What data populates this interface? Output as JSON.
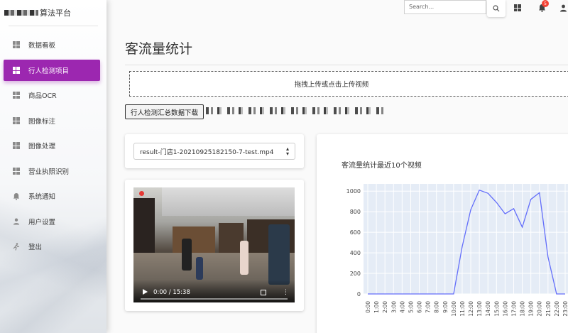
{
  "sidebar": {
    "logo_text": "算法平台",
    "items": [
      {
        "label": "数据看板",
        "icon": "dashboard-icon",
        "active": false
      },
      {
        "label": "行人检测项目",
        "icon": "dashboard-icon",
        "active": true
      },
      {
        "label": "商品OCR",
        "icon": "dashboard-icon",
        "active": false
      },
      {
        "label": "图像标注",
        "icon": "dashboard-icon",
        "active": false
      },
      {
        "label": "图像处理",
        "icon": "dashboard-icon",
        "active": false
      },
      {
        "label": "营业执照识别",
        "icon": "dashboard-icon",
        "active": false
      },
      {
        "label": "系统通知",
        "icon": "bell-icon",
        "active": false
      },
      {
        "label": "用户设置",
        "icon": "person-icon",
        "active": false
      },
      {
        "label": "登出",
        "icon": "run-icon",
        "active": false
      }
    ]
  },
  "topbar": {
    "search_placeholder": "Search...",
    "notification_count": "5"
  },
  "main": {
    "title": "客流量统计",
    "upload_text": "拖拽上传或点击上传视频",
    "download_button": "行人检测汇总数据下载",
    "video_select": {
      "selected": "result-门店1-20210925182150-7-test.mp4"
    },
    "video": {
      "time": "0:00 / 15:38"
    }
  },
  "colors": {
    "accent": "#9c27b0",
    "chart_line": "#636efa",
    "chart_bg": "#e5ecf6",
    "badge": "#f44336"
  },
  "chart_data": {
    "type": "line",
    "title": "客流量统计最近10个视频",
    "categories": [
      "0:00",
      "1:00",
      "2:00",
      "3:00",
      "4:00",
      "5:00",
      "6:00",
      "7:00",
      "8:00",
      "9:00",
      "10:00",
      "11:00",
      "12:00",
      "13:00",
      "14:00",
      "15:00",
      "16:00",
      "17:00",
      "18:00",
      "19:00",
      "20:00",
      "21:00",
      "22:00",
      "23:00"
    ],
    "series": [
      {
        "values": [
          0,
          0,
          0,
          0,
          0,
          0,
          0,
          0,
          0,
          0,
          0,
          460,
          820,
          1010,
          980,
          890,
          780,
          830,
          650,
          920,
          985,
          360,
          0,
          0
        ]
      }
    ],
    "ylim": [
      0,
      1050
    ],
    "yticks": [
      0,
      200,
      400,
      600,
      800,
      1000
    ],
    "grid": true
  }
}
